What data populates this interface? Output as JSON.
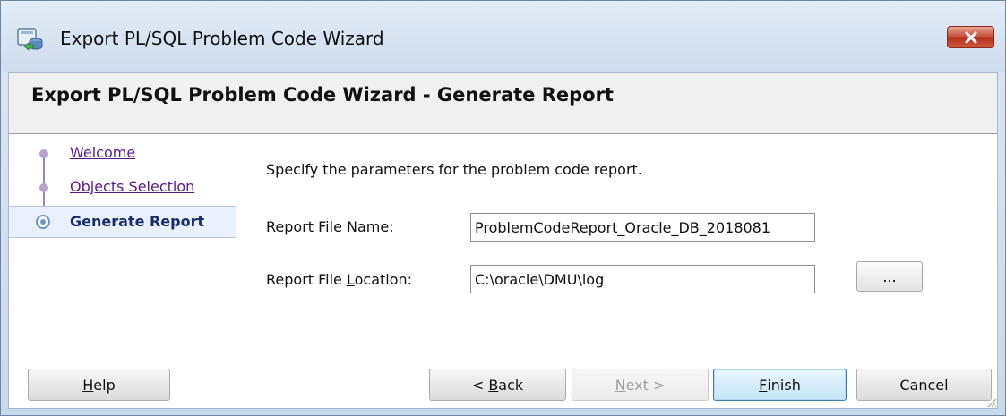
{
  "window": {
    "title": "Export PL/SQL Problem Code Wizard",
    "close_symbol": "✕",
    "icon": "database-export-icon"
  },
  "header": {
    "title": "Export PL/SQL Problem Code Wizard - Generate Report"
  },
  "steps": [
    {
      "label": "Welcome",
      "state": "visited"
    },
    {
      "label": "Objects Selection",
      "state": "visited"
    },
    {
      "label": "Generate Report",
      "state": "current"
    }
  ],
  "content": {
    "intro": "Specify the parameters for the problem code report.",
    "report_file_name": {
      "label_prefix": "",
      "label_mnemonic": "R",
      "label_suffix": "eport File Name:",
      "value": "ProblemCodeReport_Oracle_DB_2018081"
    },
    "report_file_location": {
      "label_prefix": "Report File ",
      "label_mnemonic": "L",
      "label_suffix": "ocation:",
      "value": "C:\\oracle\\DMU\\log"
    },
    "browse_label": "..."
  },
  "buttons": {
    "help": {
      "mnemonic": "H",
      "rest": "elp"
    },
    "back": {
      "prefix": "< ",
      "mnemonic": "B",
      "rest": "ack"
    },
    "next": {
      "mnemonic": "N",
      "rest": "ext >"
    },
    "finish": {
      "mnemonic": "F",
      "rest": "inish"
    },
    "cancel": "Cancel"
  },
  "colors": {
    "visited_link": "#5a1b8a",
    "current_step": "#1a2c6b",
    "close_button": "#c8493a",
    "default_button_border": "#3c7fb1"
  }
}
